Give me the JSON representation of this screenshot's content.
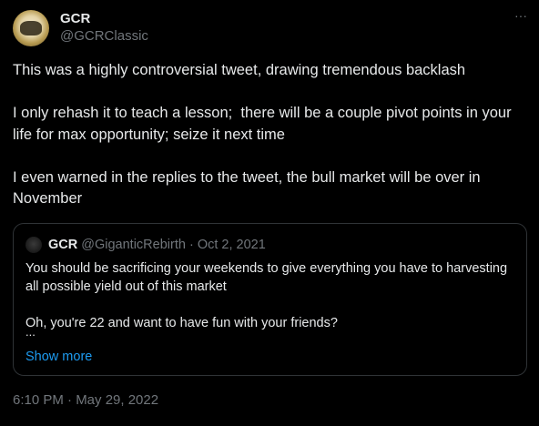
{
  "author": {
    "display_name": "GCR",
    "handle": "@GCRClassic"
  },
  "menu": {
    "more_icon": "more-horizontal-icon",
    "more_label": "···"
  },
  "tweet": {
    "paragraphs": [
      "This was a highly controversial tweet, drawing tremendous backlash",
      "I only rehash it to teach a lesson;  there will be a couple pivot points in your life for max opportunity; seize it next time",
      "I even warned in the replies to the tweet, the bull market will be over in November"
    ]
  },
  "quoted_tweet": {
    "display_name": "GCR",
    "handle": "@GiganticRebirth",
    "separator": "·",
    "date": "Oct 2, 2021",
    "paragraphs": [
      "You should be sacrificing your weekends to give everything you have to harvesting all possible yield out of this market",
      "Oh, you're 22 and want to have fun with your friends?"
    ],
    "ellipsis": "...",
    "show_more": "Show more"
  },
  "timestamp": "6:10 PM · May 29, 2022",
  "colors": {
    "background": "#000000",
    "text_primary": "#e7e9ea",
    "text_secondary": "#71767b",
    "link": "#1d9bf0",
    "border": "#2f3336"
  }
}
